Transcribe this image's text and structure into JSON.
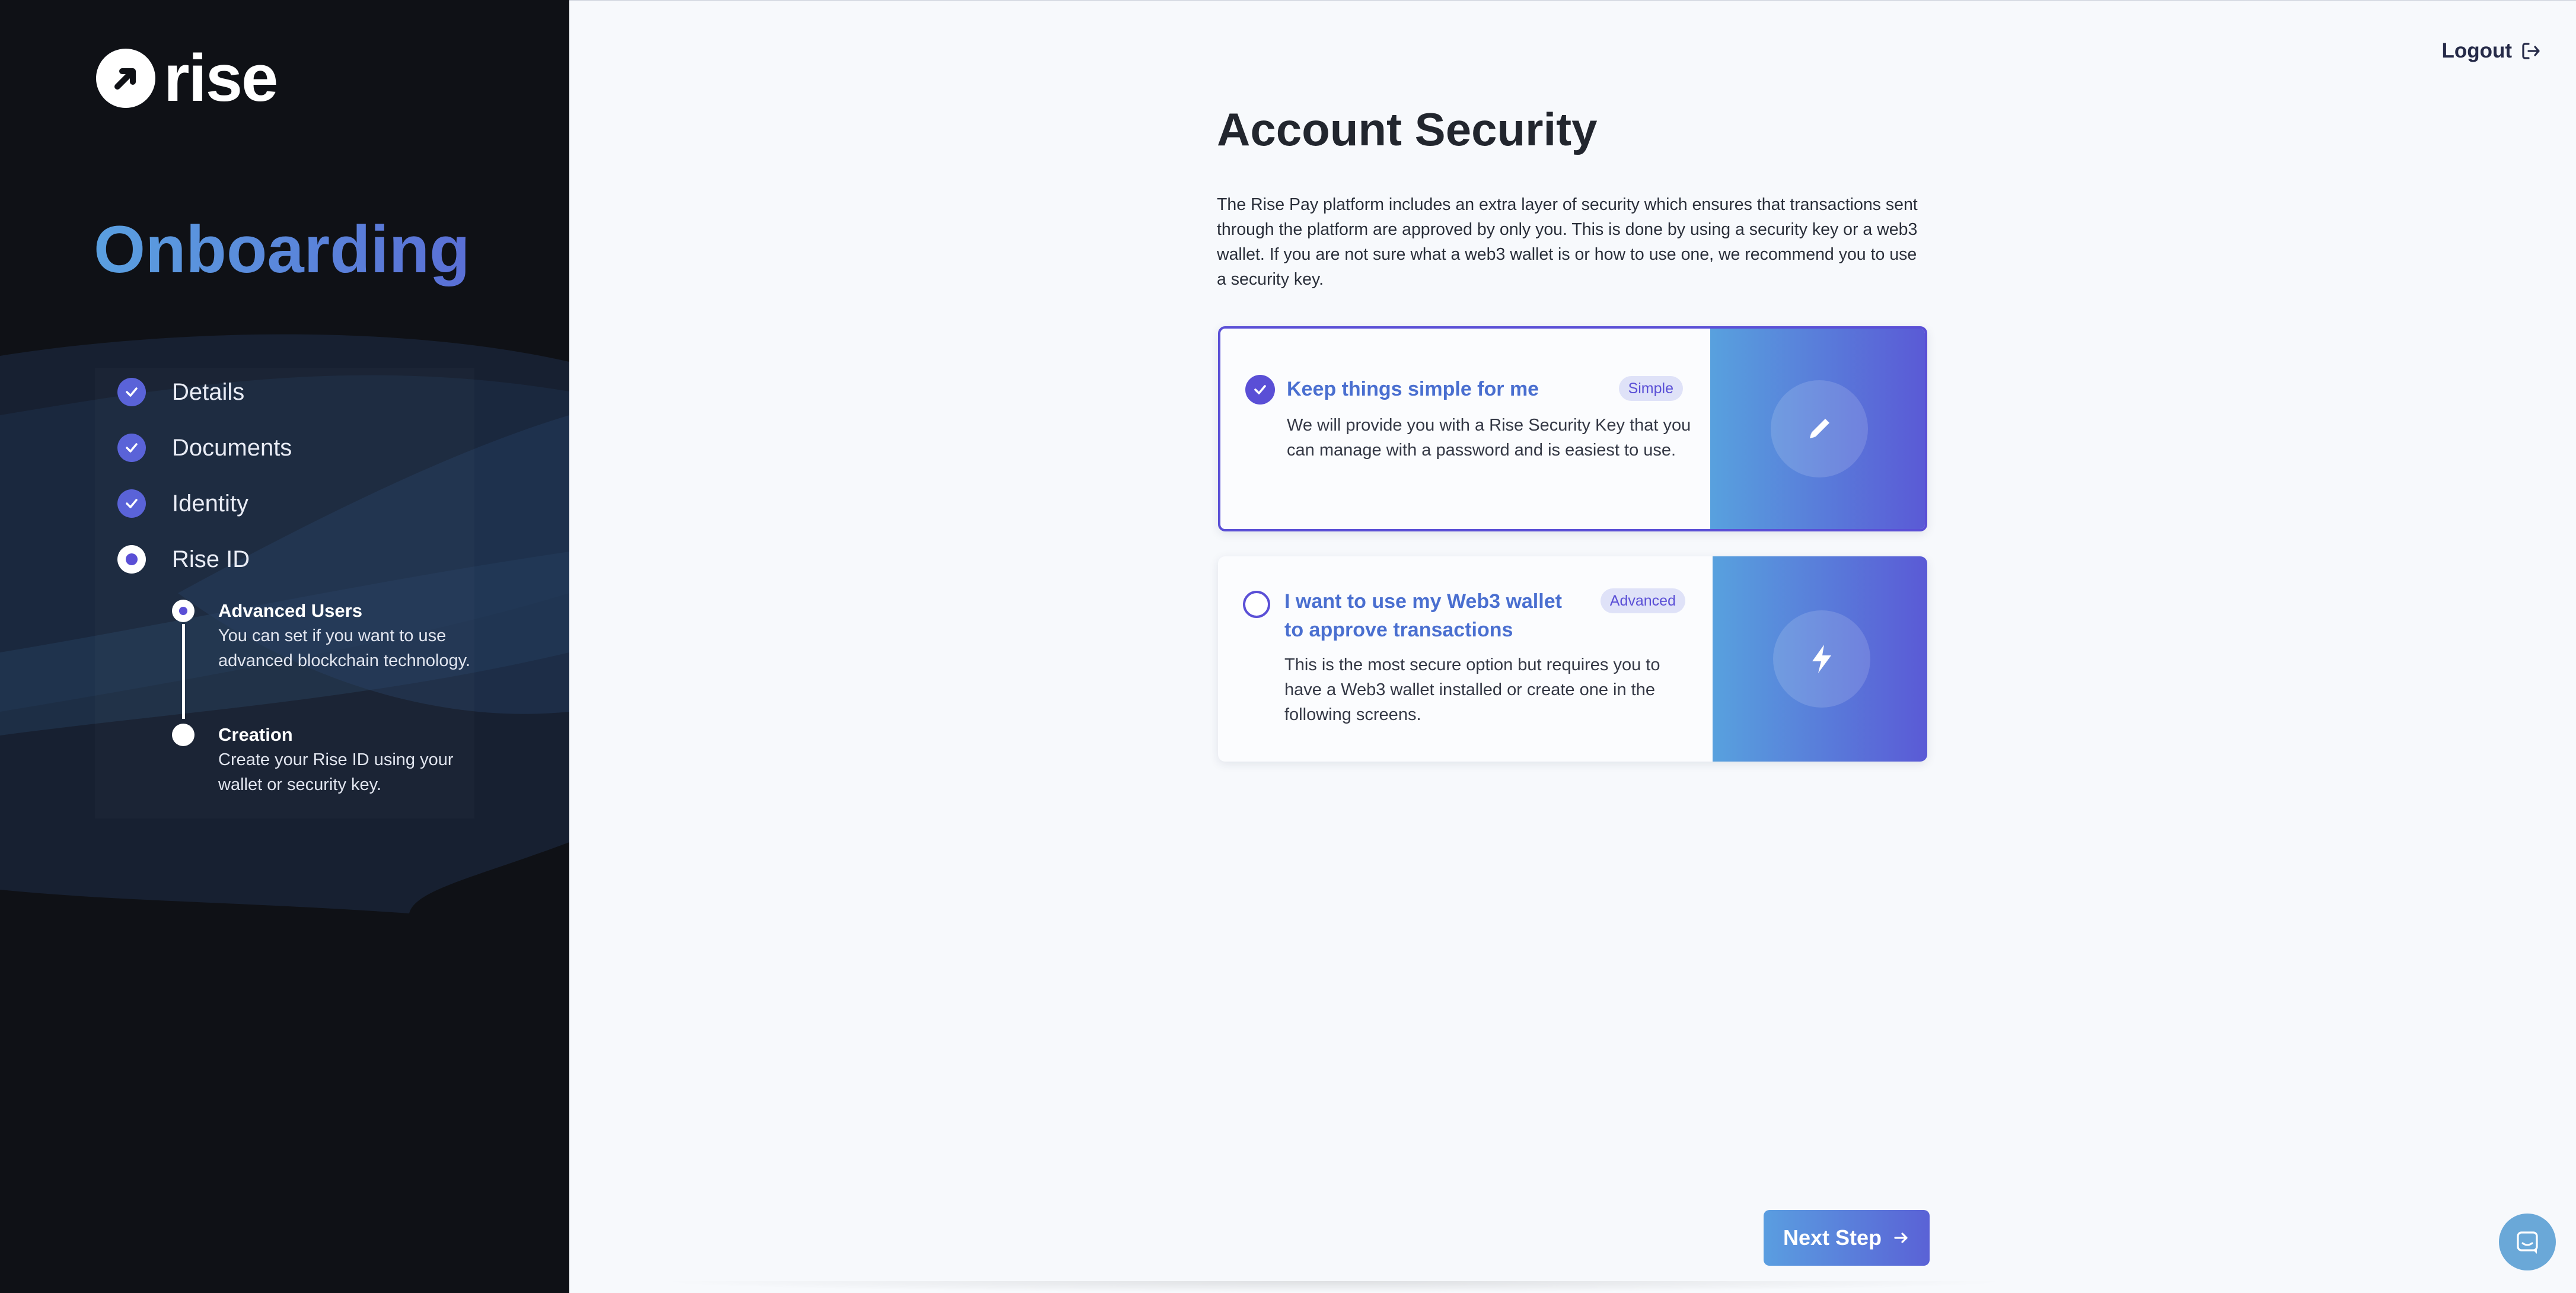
{
  "brand": {
    "name": "rise"
  },
  "sidebar": {
    "title": "Onboarding",
    "steps": [
      {
        "label": "Details",
        "status": "complete"
      },
      {
        "label": "Documents",
        "status": "complete"
      },
      {
        "label": "Identity",
        "status": "complete"
      },
      {
        "label": "Rise ID",
        "status": "current"
      }
    ],
    "substeps": [
      {
        "title": "Advanced Users",
        "description": "You can set if you want to use advanced blockchain technology.",
        "status": "current"
      },
      {
        "title": "Creation",
        "description": "Create your Rise ID using your wallet or security key.",
        "status": "upcoming"
      }
    ]
  },
  "header": {
    "logout_label": "Logout"
  },
  "main": {
    "title": "Account Security",
    "intro": "The Rise Pay platform includes an extra layer of security which ensures that transactions sent through the platform are approved by only you. This is done by using a security key or a web3 wallet. If you are not sure what a web3 wallet is or how to use one, we recommend you to use a security key.",
    "options": [
      {
        "title": "Keep things simple for me",
        "badge": "Simple",
        "description": "We will provide you with a Rise Security Key that you can manage with a password and is easiest to use.",
        "selected": true,
        "icon": "pencil-icon"
      },
      {
        "title": "I want to use my Web3 wallet to approve transactions",
        "badge": "Advanced",
        "description": "This is the most secure option but requires you to have a Web3 wallet installed or create one in the following screens.",
        "selected": false,
        "icon": "lightning-icon"
      }
    ],
    "next_label": "Next Step"
  },
  "colors": {
    "accent": "#5a4fd6",
    "sidebar_bg": "#0f1116",
    "gradient_start": "#58a1de",
    "gradient_end": "#5a5ad6"
  }
}
